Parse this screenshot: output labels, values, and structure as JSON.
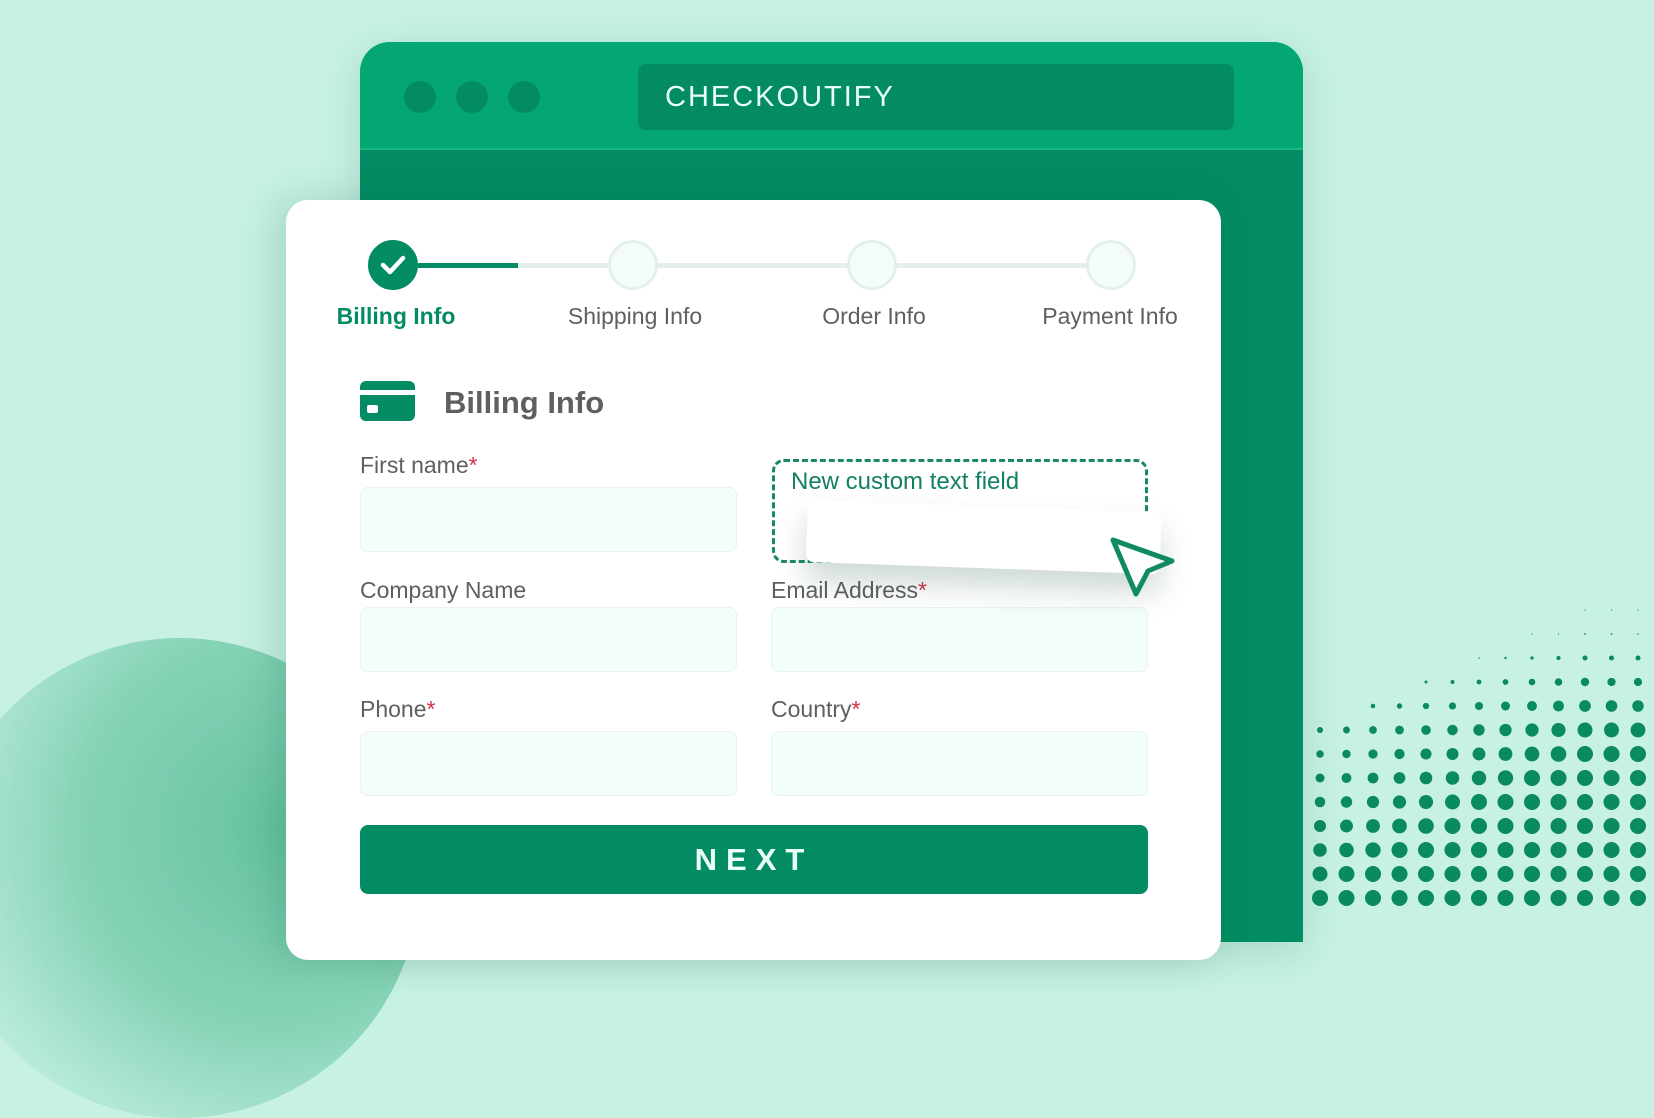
{
  "app": {
    "title": "CHECKOUTIFY",
    "window_controls": [
      "close-dot",
      "minimize-dot",
      "maximize-dot"
    ]
  },
  "stepper": {
    "steps": [
      {
        "label": "Billing Info",
        "state": "completed"
      },
      {
        "label": "Shipping Info",
        "state": "pending"
      },
      {
        "label": "Order Info",
        "state": "pending"
      },
      {
        "label": "Payment Info",
        "state": "pending"
      }
    ],
    "progress_fraction": 0.17
  },
  "section": {
    "icon": "credit-card-icon",
    "title": "Billing Info"
  },
  "form": {
    "fields": [
      {
        "label": "First name",
        "required": true,
        "required_marker": "*",
        "value": "",
        "placeholder": ""
      },
      {
        "label": "Company Name",
        "required": false,
        "value": "",
        "placeholder": ""
      },
      {
        "label": "Email Address",
        "required": true,
        "required_marker": "*",
        "value": "",
        "placeholder": ""
      },
      {
        "label": "Phone",
        "required": true,
        "required_marker": "*",
        "value": "",
        "placeholder": ""
      },
      {
        "label": "Country",
        "required": true,
        "required_marker": "*",
        "value": "",
        "placeholder": ""
      }
    ],
    "custom_field": {
      "label": "New custom text field",
      "value": ""
    },
    "next_label": "NEXT"
  },
  "colors": {
    "brand": "#038c63",
    "brand_light": "#04a674",
    "background": "#c6f1e3",
    "required": "#d6324a",
    "text": "#5d5f60"
  }
}
